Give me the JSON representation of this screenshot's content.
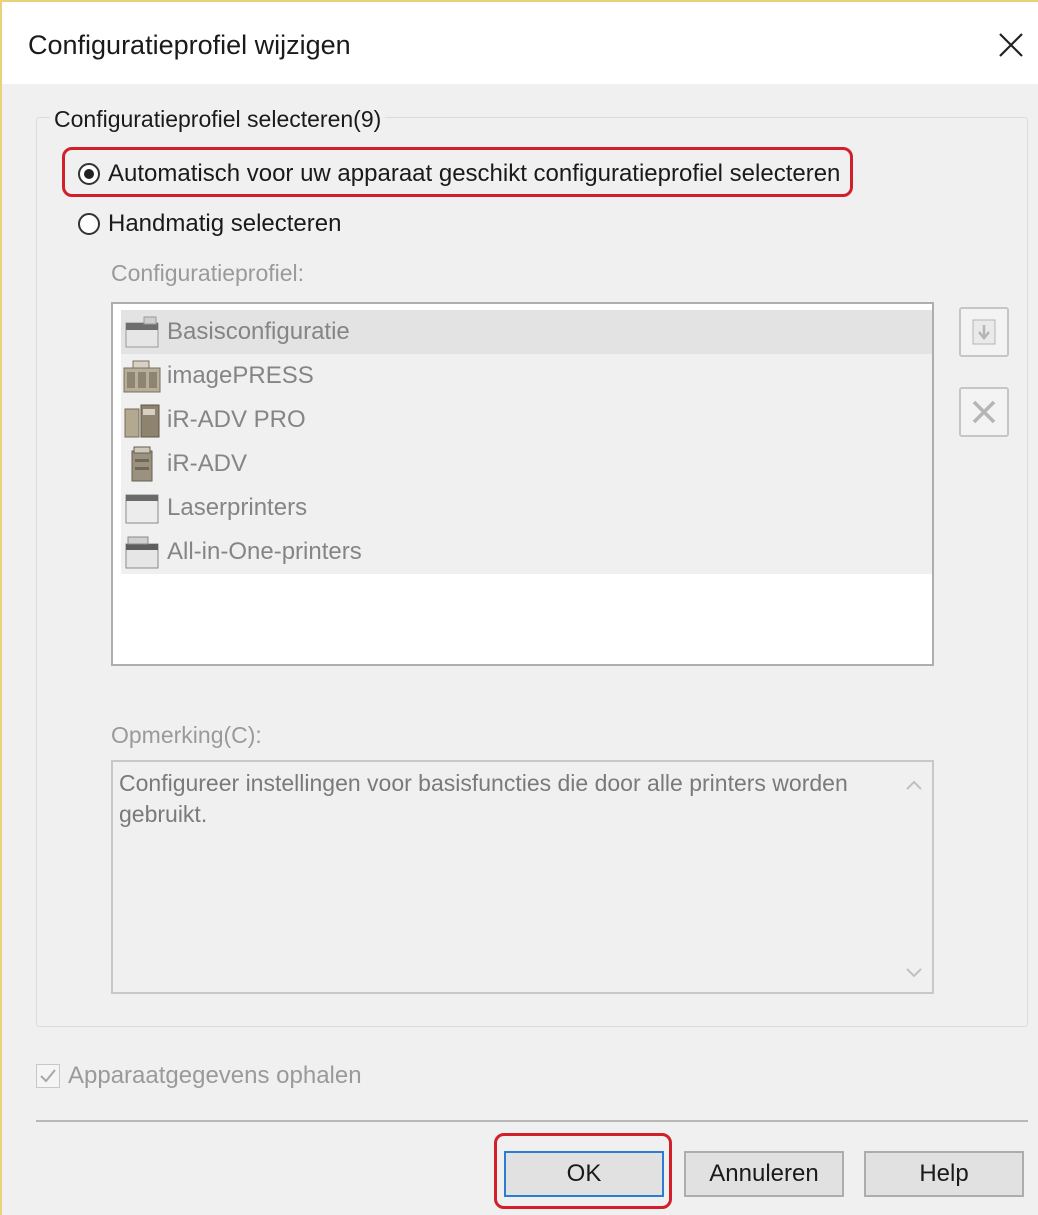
{
  "window": {
    "title": "Configuratieprofiel wijzigen"
  },
  "group": {
    "legend": "Configuratieprofiel selecteren(9)",
    "options": [
      {
        "label": "Automatisch voor uw apparaat geschikt configuratieprofiel selecteren",
        "checked": true
      },
      {
        "label": "Handmatig selecteren",
        "checked": false
      }
    ],
    "profile_label": "Configuratieprofiel:",
    "profiles": [
      {
        "label": "Basisconfiguratie",
        "icon": "basic-printer-icon"
      },
      {
        "label": "imagePRESS",
        "icon": "imagepress-icon"
      },
      {
        "label": "iR-ADV PRO",
        "icon": "ir-adv-pro-icon"
      },
      {
        "label": "iR-ADV",
        "icon": "ir-adv-icon"
      },
      {
        "label": "Laserprinters",
        "icon": "laser-printer-icon"
      },
      {
        "label": "All-in-One-printers",
        "icon": "all-in-one-printer-icon"
      }
    ],
    "comment_label": "Opmerking(C):",
    "comment_text": "Configureer instellingen voor basisfuncties die door alle printers worden gebruikt."
  },
  "checkbox": {
    "label": "Apparaatgegevens ophalen",
    "checked": true
  },
  "buttons": {
    "ok": "OK",
    "cancel": "Annuleren",
    "help": "Help"
  },
  "colors": {
    "highlight": "#d21f2a",
    "default_button_border": "#2b7cd3"
  }
}
